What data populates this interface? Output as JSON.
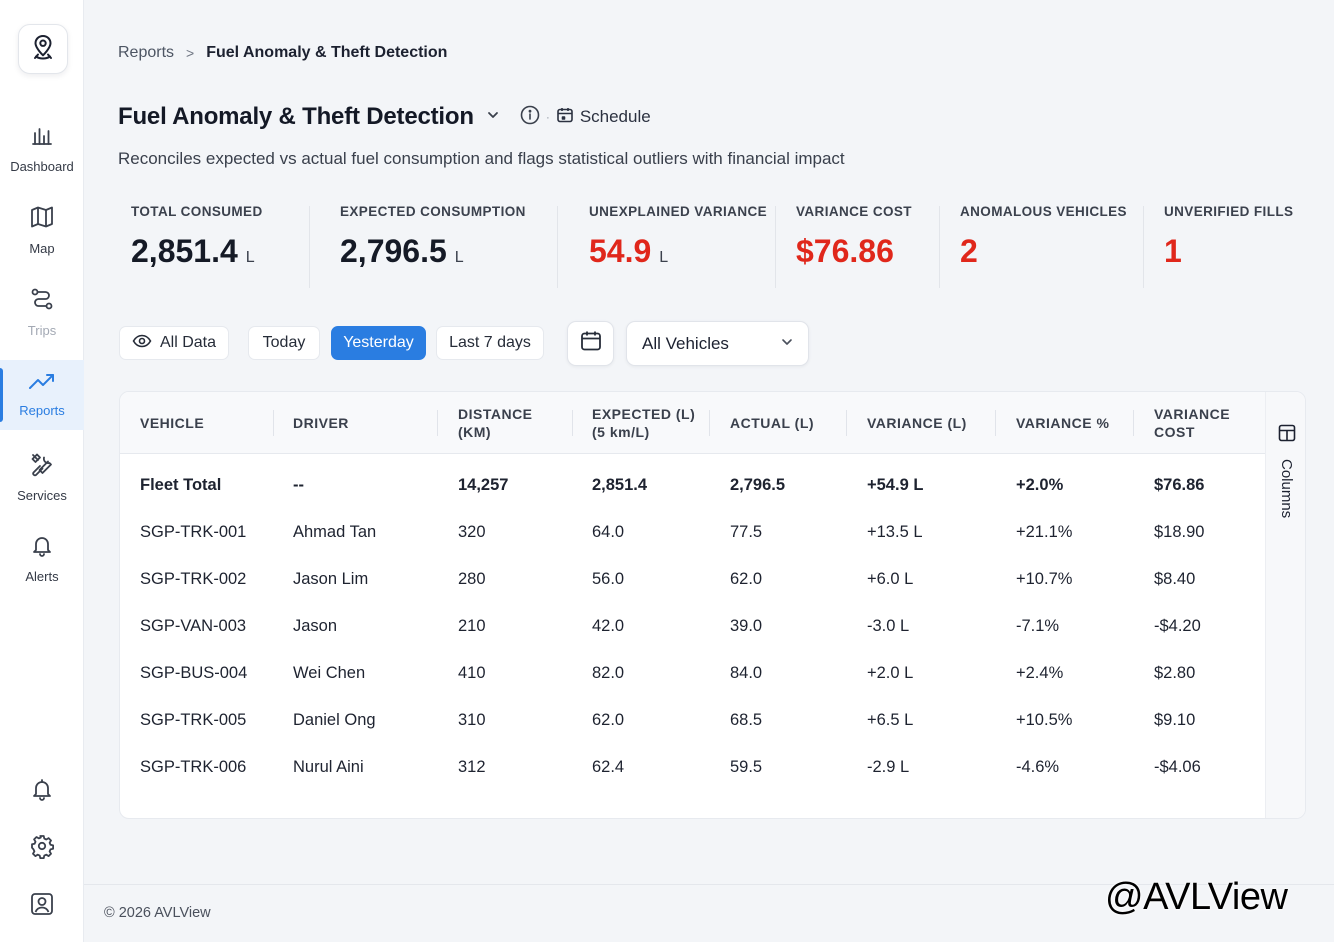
{
  "sidebar": {
    "nav": [
      {
        "label": "Dashboard",
        "icon": "bar-chart-icon"
      },
      {
        "label": "Map",
        "icon": "map-icon"
      },
      {
        "label": "Trips",
        "icon": "route-icon"
      },
      {
        "label": "Reports",
        "icon": "trending-up-icon",
        "active": true
      },
      {
        "label": "Services",
        "icon": "tools-icon"
      },
      {
        "label": "Alerts",
        "icon": "bell-icon"
      }
    ]
  },
  "breadcrumb": {
    "parent": "Reports",
    "separator": ">",
    "current": "Fuel Anomaly & Theft Detection"
  },
  "header": {
    "title": "Fuel Anomaly & Theft Detection",
    "schedule_label": "Schedule",
    "subtitle": "Reconciles expected vs actual fuel consumption and flags statistical outliers with financial impact"
  },
  "kpis": [
    {
      "label": "TOTAL CONSUMED",
      "value": "2,851.4",
      "unit": "L"
    },
    {
      "label": "EXPECTED CONSUMPTION",
      "value": "2,796.5",
      "unit": "L"
    },
    {
      "label": "UNEXPLAINED VARIANCE",
      "value": "54.9",
      "unit": "L",
      "color": "#e0271b"
    },
    {
      "label": "VARIANCE COST",
      "value": "$76.86",
      "color": "#e0271b"
    },
    {
      "label": "ANOMALOUS VEHICLES",
      "value": "2",
      "color": "#e0271b"
    },
    {
      "label": "UNVERIFIED FILLS",
      "value": "1",
      "color": "#e0271b"
    }
  ],
  "filters": {
    "all_data": "All Data",
    "today": "Today",
    "yesterday": "Yesterday",
    "last7": "Last 7 days",
    "selected": "Yesterday",
    "vehicle_select": "All Vehicles",
    "accent": "#2a7de1"
  },
  "table": {
    "headers": [
      [
        "VEHICLE"
      ],
      [
        "DRIVER"
      ],
      [
        "DISTANCE",
        "(KM)"
      ],
      [
        "EXPECTED (L)",
        "(5 km/L)"
      ],
      [
        "ACTUAL (L)"
      ],
      [
        "VARIANCE (L)"
      ],
      [
        "VARIANCE %"
      ],
      [
        "VARIANCE",
        "COST"
      ]
    ],
    "rows": [
      [
        "Fleet Total",
        "--",
        "14,257",
        "2,851.4",
        "2,796.5",
        "+54.9 L",
        "+2.0%",
        "$76.86"
      ],
      [
        "SGP-TRK-001",
        "Ahmad Tan",
        "320",
        "64.0",
        "77.5",
        "+13.5 L",
        "+21.1%",
        "$18.90"
      ],
      [
        "SGP-TRK-002",
        "Jason Lim",
        "280",
        "56.0",
        "62.0",
        "+6.0 L",
        "+10.7%",
        "$8.40"
      ],
      [
        "SGP-VAN-003",
        "Jason",
        "210",
        "42.0",
        "39.0",
        "-3.0 L",
        "-7.1%",
        "-$4.20"
      ],
      [
        "SGP-BUS-004",
        "Wei Chen",
        "410",
        "82.0",
        "84.0",
        "+2.0 L",
        "+2.4%",
        "$2.80"
      ],
      [
        "SGP-TRK-005",
        "Daniel Ong",
        "310",
        "62.0",
        "68.5",
        "+6.5 L",
        "+10.5%",
        "$9.10"
      ],
      [
        "SGP-TRK-006",
        "Nurul Aini",
        "312",
        "62.4",
        "59.5",
        "-2.9 L",
        "-4.6%",
        "-$4.06"
      ]
    ],
    "columns_label": "Columns"
  },
  "footer": {
    "copyright": "© 2026 AVLView"
  },
  "watermark": "@AVLView"
}
